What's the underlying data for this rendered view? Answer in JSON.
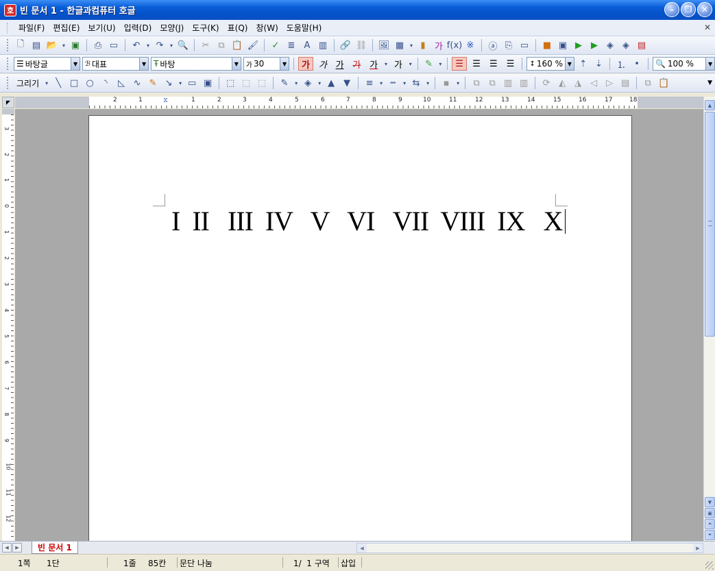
{
  "window": {
    "title": "빈 문서 1 - 한글과컴퓨터 호글",
    "app_icon_glyph": "호"
  },
  "menu": [
    "파일(F)",
    "편집(E)",
    "보기(U)",
    "입력(D)",
    "모양(J)",
    "도구(K)",
    "표(Q)",
    "창(W)",
    "도움말(H)"
  ],
  "format_bar": {
    "style": "바탕글",
    "lang": "대표",
    "font": "바탕",
    "size": "30",
    "line_spacing": "160 %",
    "zoom": "100 %"
  },
  "draw_bar": {
    "label": "그리기"
  },
  "ruler": {
    "h_ticks": [
      "2",
      "1",
      "1",
      "1",
      "2",
      "3",
      "4",
      "5",
      "6",
      "7",
      "8",
      "9",
      "10",
      "11",
      "12",
      "13",
      "14",
      "15",
      "16",
      "17",
      "18"
    ],
    "v_ticks": [
      "3",
      "2",
      "1",
      "0",
      "1",
      "2",
      "3",
      "4",
      "5",
      "6",
      "7",
      "8",
      "9",
      "10",
      "11",
      "12"
    ]
  },
  "document": {
    "text": "I  II   III  IV   V   VI   VII  VIII  IX   X"
  },
  "tabs": [
    {
      "label": "빈 문서 1"
    }
  ],
  "status": {
    "page": "1쪽",
    "column": "1단",
    "line": "1줄",
    "char": "85칸",
    "mode": "문단 나눔",
    "section": "1/  1 구역",
    "insert": "삽입"
  }
}
